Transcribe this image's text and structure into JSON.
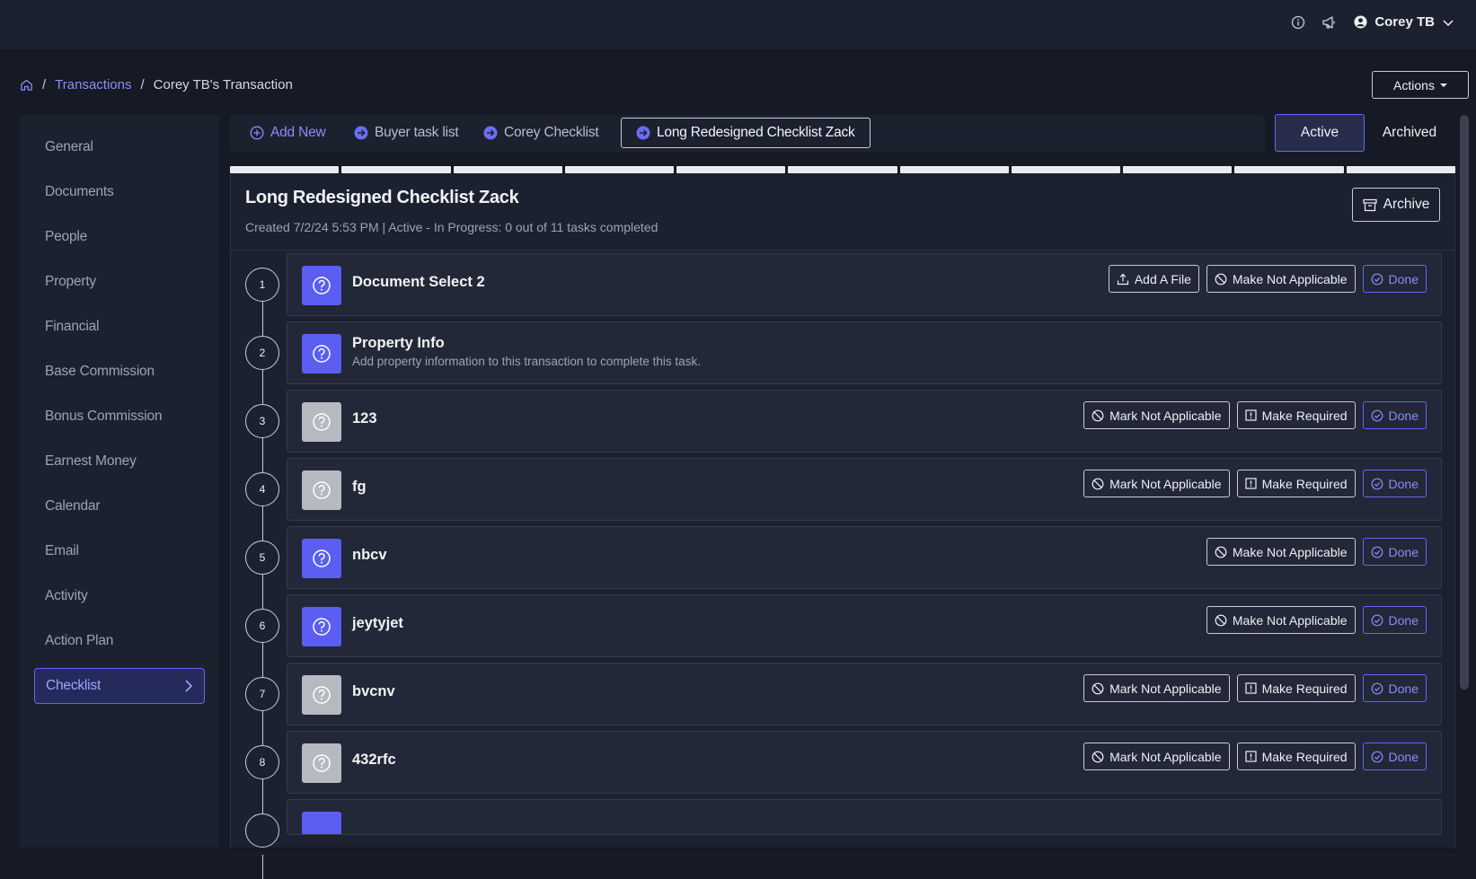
{
  "topbar": {
    "user_name": "Corey TB"
  },
  "breadcrumb": {
    "transactions": "Transactions",
    "sep1": "/",
    "sep2": "/",
    "current": "Corey TB's Transaction"
  },
  "actions_label": "Actions",
  "sidebar": {
    "items": [
      {
        "label": "General"
      },
      {
        "label": "Documents"
      },
      {
        "label": "People"
      },
      {
        "label": "Property"
      },
      {
        "label": "Financial"
      },
      {
        "label": "Base Commission"
      },
      {
        "label": "Bonus Commission"
      },
      {
        "label": "Earnest Money"
      },
      {
        "label": "Calendar"
      },
      {
        "label": "Email"
      },
      {
        "label": "Activity"
      },
      {
        "label": "Action Plan"
      },
      {
        "label": "Checklist"
      }
    ],
    "active": "Checklist"
  },
  "tabs": {
    "add_new": "Add New",
    "items": [
      {
        "label": "Buyer task list"
      },
      {
        "label": "Corey Checklist"
      },
      {
        "label": "Long Redesigned Checklist Zack"
      }
    ]
  },
  "status_filter": {
    "active": "Active",
    "archived": "Archived"
  },
  "checklist": {
    "title": "Long Redesigned Checklist Zack",
    "subtitle": "Created 7/2/24 5:53 PM  |  Active - In Progress: 0 out of 11 tasks completed",
    "archive_label": "Archive",
    "progress_segments": 11,
    "progress_completed": 0,
    "tasks": [
      {
        "num": "1",
        "name": "Document Select 2",
        "color": "blue",
        "buttons": [
          "Add A File",
          "Make Not Applicable",
          "Done"
        ]
      },
      {
        "num": "2",
        "name": "Property Info",
        "desc": "Add property information to this transaction to complete this task.",
        "color": "blue",
        "buttons": []
      },
      {
        "num": "3",
        "name": "123",
        "color": "grey",
        "buttons": [
          "Mark Not Applicable",
          "Make Required",
          "Done"
        ]
      },
      {
        "num": "4",
        "name": "fg",
        "color": "grey",
        "buttons": [
          "Mark Not Applicable",
          "Make Required",
          "Done"
        ]
      },
      {
        "num": "5",
        "name": "nbcv",
        "color": "blue",
        "buttons": [
          "Make Not Applicable",
          "Done"
        ]
      },
      {
        "num": "6",
        "name": "jeytyjet",
        "color": "blue",
        "buttons": [
          "Make Not Applicable",
          "Done"
        ]
      },
      {
        "num": "7",
        "name": "bvcnv",
        "color": "grey",
        "buttons": [
          "Mark Not Applicable",
          "Make Required",
          "Done"
        ]
      },
      {
        "num": "8",
        "name": "432rfc",
        "color": "grey",
        "buttons": [
          "Mark Not Applicable",
          "Make Required",
          "Done"
        ]
      }
    ]
  },
  "colors": {
    "accent": "#6467f2",
    "background": "#161a24",
    "panel": "#1c2130",
    "task_blue": "#5b5ef0",
    "task_grey": "#b7b9c0"
  },
  "icons": {
    "info": "info-icon",
    "announce": "megaphone-icon",
    "user": "user-circle-icon",
    "home": "home-icon"
  }
}
